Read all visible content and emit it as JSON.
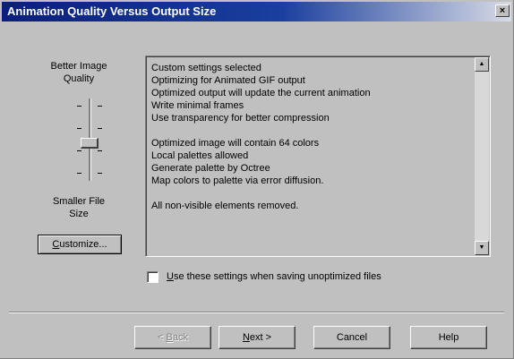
{
  "window": {
    "title": "Animation Quality Versus Output Size",
    "close_glyph": "×"
  },
  "left_panel": {
    "top_label_line1": "Better Image",
    "top_label_line2": "Quality",
    "bottom_label_line1": "Smaller File",
    "bottom_label_line2": "Size",
    "customize_prefix": "C",
    "customize_rest": "ustomize...",
    "slider_position": 0.55
  },
  "info_box": {
    "lines": [
      "Custom settings selected",
      "Optimizing for Animated GIF output",
      "Optimized output will update the current animation",
      "Write minimal frames",
      "Use transparency for better compression",
      "",
      "Optimized image will contain 64 colors",
      "Local palettes allowed",
      "Generate palette by Octree",
      "Map colors to palette via error diffusion.",
      "",
      "All non-visible elements removed."
    ]
  },
  "checkbox": {
    "label_prefix": "U",
    "label_rest": "se these settings when saving unoptimized files",
    "checked": false
  },
  "buttons": {
    "back_prefix": "< ",
    "back_ul": "B",
    "back_rest": "ack",
    "next_ul": "N",
    "next_rest": "ext >",
    "cancel": "Cancel",
    "help": "Help"
  }
}
